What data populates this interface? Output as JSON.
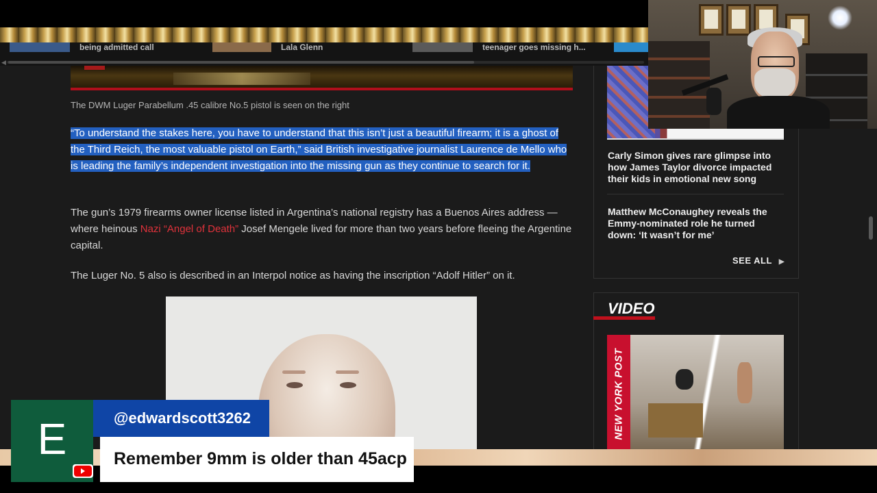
{
  "trending": [
    {
      "label": "being admitted call"
    },
    {
      "label": "Lala Glenn"
    },
    {
      "label": "teenager goes missing h..."
    }
  ],
  "article": {
    "caption": "The DWM Luger Parabellum .45 calibre No.5 pistol is seen on the right",
    "quote": "“To understand the stakes here, you have to understand that this isn’t just a beautiful firearm; it is a ghost of the Third Reich, the most valuable pistol on Earth,” said British investigative journalist Laurence de Mello who is leading the family’s independent investigation into the missing gun as they continue to search for it.",
    "para2_before": "The gun’s 1979 firearms owner license listed in  Argentina’s national registry has a Buenos Aires address — where heinous ",
    "para2_link": "Nazi “Angel of Death”",
    "para2_after": " Josef Mengele lived for more than two years before fleeing the Argentine capital.",
    "para3": "The Luger No. 5 also is described in an Interpol notice as having the inscription “Adolf Hitler” on it."
  },
  "sidebar": {
    "headline1": "Carly Simon gives rare glimpse into how James Taylor divorce impacted their kids in emotional new song",
    "headline2": "Matthew McConaughey reveals the Emmy-nominated role he turned down: ‘It wasn’t for me’",
    "see_all": "SEE ALL",
    "see_all_icon": "chevron-right-icon",
    "video_title": "VIDEO",
    "video_brand": "NEW YORK POST"
  },
  "chat": {
    "avatar_letter": "E",
    "username": "@edwardscott3262",
    "message": "Remember 9mm is older than 45acp",
    "platform_icon": "youtube-icon"
  },
  "colors": {
    "highlight": "#2360c0",
    "link": "#e0323b",
    "avatar_bg": "#0f5c3c",
    "name_bg": "#0f45a6",
    "accent_red": "#c0101c"
  }
}
